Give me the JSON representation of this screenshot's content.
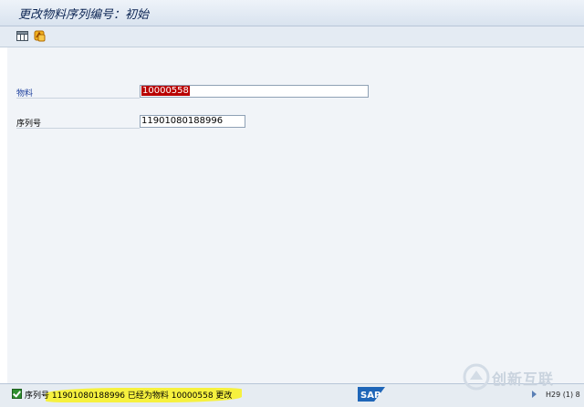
{
  "window": {
    "title": "更改物料序列编号：初始"
  },
  "toolbar": {
    "icons": [
      "grid-icon",
      "copy-icon"
    ]
  },
  "form": {
    "material_label": "物料",
    "material_value": "10000558",
    "serial_label": "序列号",
    "serial_value": "11901080188996"
  },
  "status": {
    "message": "序列号 11901080188996 已经为物料 10000558 更改",
    "session": "H29 (1) 8",
    "logo": "SAP"
  },
  "watermark": {
    "text": "创新互联"
  },
  "colors": {
    "accent": "#1a3d9c",
    "selection": "#b80000",
    "highlight": "#f7f22a"
  }
}
